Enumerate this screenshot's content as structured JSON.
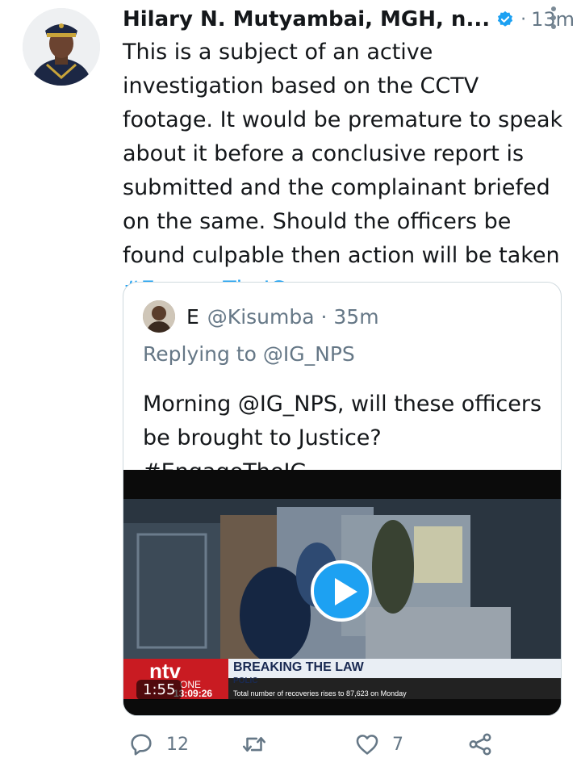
{
  "tweet": {
    "author_name": "Hilary N. Mutyambai, MGH, n...",
    "time": "13m",
    "dot": "·",
    "text": "This is a subject of an active investigation based on the CCTV footage. It would be premature to speak about it before a conclusive report is submitted and the complainant briefed on the same. Should the officers be found culpable then action will be taken ",
    "hashtag": "#EngageTheIG"
  },
  "quote": {
    "name": "E",
    "handle": "@Kisumba · 35m",
    "replying": "Replying to @IG_NPS",
    "text": "Morning @IG_NPS, will these officers be brought to Justice? #EngageTheIG",
    "video": {
      "duration": "1:55",
      "channel": "ntv",
      "channel_sub": "ONE",
      "headline": "BREAKING THE LAW",
      "sub_label": "POLIC",
      "clock": "13:09:26",
      "ticker": "Total number of recoveries rises to 87,623 on Monday"
    }
  },
  "actions": {
    "reply_count": "12",
    "retweet_count": "",
    "like_count": "7"
  },
  "colors": {
    "accent": "#1da1f2",
    "muted": "#657786",
    "text": "#14171a",
    "border": "#cfd9de"
  }
}
